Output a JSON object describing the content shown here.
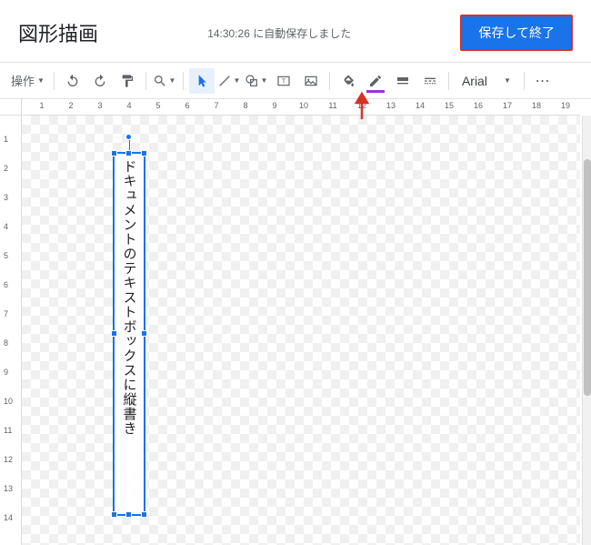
{
  "header": {
    "title": "図形描画",
    "autosave": "14:30:26 に自動保存しました",
    "save_close": "保存して終了"
  },
  "toolbar": {
    "actions_label": "操作",
    "font_name": "Arial"
  },
  "shape": {
    "text": "ドキュメントのテキストボックスに縦書き"
  },
  "ruler": {
    "h_max": 19,
    "v_max": 14
  }
}
